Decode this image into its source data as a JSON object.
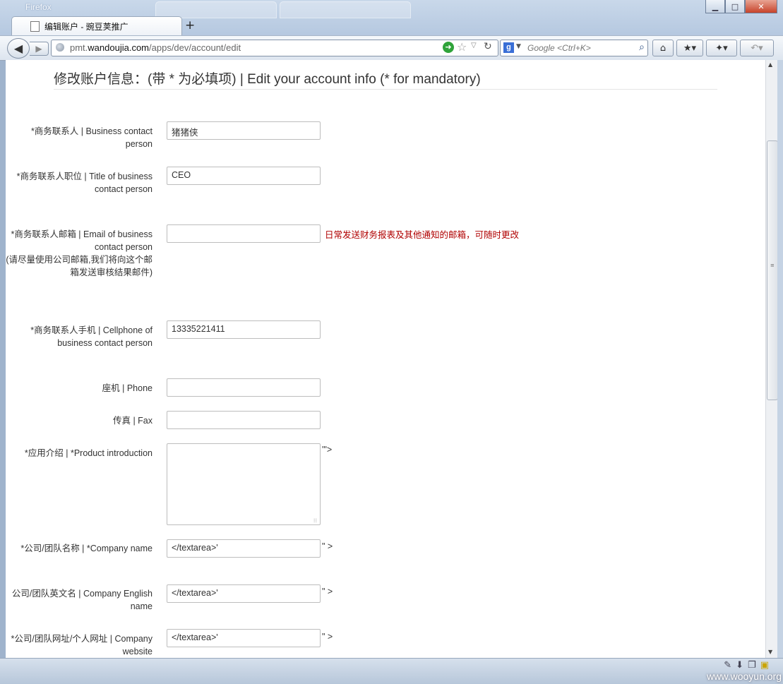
{
  "browser": {
    "app_name": "Firefox",
    "tab_title": "编辑账户 - 豌豆荚推广",
    "new_tab": "+",
    "url_prefix": "pmt.",
    "url_domain": "wandoujia.com",
    "url_path": "/apps/dev/account/edit",
    "search_placeholder": "Google <Ctrl+K>",
    "watermark": "www.wooyun.org"
  },
  "page": {
    "title": "修改账户信息：(带 * 为必填项) | Edit your account info (* for mandatory)",
    "email_hint": "日常发送财务报表及其他通知的邮箱，可随时更改"
  },
  "form": {
    "business_contact": {
      "label": "*商务联系人 | Business contact person",
      "value": "猪猪侠"
    },
    "contact_title": {
      "label": "*商务联系人职位 | Title of business contact person",
      "value": "CEO"
    },
    "contact_email": {
      "label": "*商务联系人邮箱 | Email of business contact person",
      "note": "(请尽量使用公司邮箱,我们将向这个邮箱发送审核结果邮件)",
      "value": ""
    },
    "cellphone": {
      "label": "*商务联系人手机 | Cellphone of business contact person",
      "value": "13335221411"
    },
    "phone": {
      "label": "座机 | Phone",
      "value": ""
    },
    "fax": {
      "label": "传真 | Fax",
      "value": ""
    },
    "product_intro": {
      "label": "*应用介绍 | *Product introduction",
      "value": "",
      "trailing": "'\">"
    },
    "company_name": {
      "label": "*公司/团队名称 | *Company name",
      "value": "</textarea>'",
      "trailing": "\" >"
    },
    "company_english_name": {
      "label": "公司/团队英文名 | Company English name",
      "value": "</textarea>'",
      "trailing": "\" >"
    },
    "company_website": {
      "label": "*公司/团队网址/个人网址 | Company website",
      "value": "</textarea>'",
      "trailing": "\" >"
    }
  }
}
